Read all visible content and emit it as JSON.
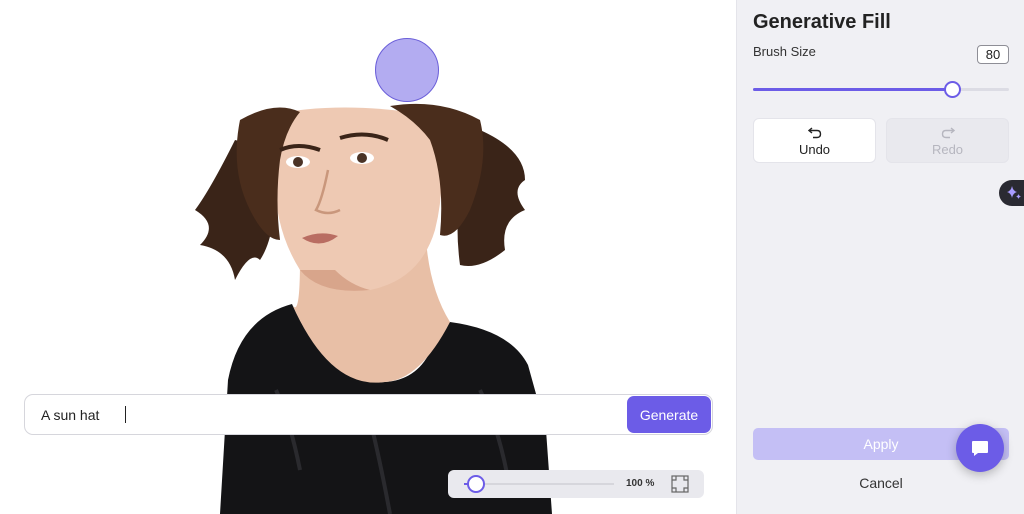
{
  "prompt": {
    "value": "A sun hat",
    "generate_label": "Generate"
  },
  "zoom": {
    "value": "100 %",
    "level_fraction": 0.05
  },
  "panel": {
    "title": "Generative Fill",
    "brush_label": "Brush Size",
    "brush_value": "80",
    "brush_fraction": 0.79,
    "undo_label": "Undo",
    "redo_label": "Redo",
    "apply_label": "Apply",
    "cancel_label": "Cancel"
  },
  "icons": {
    "undo": "undo-icon",
    "redo": "redo-icon",
    "fit": "fit-screen-icon",
    "sparkle": "sparkle-icon",
    "chat": "chat-icon"
  },
  "colors": {
    "accent": "#6c5ce7",
    "apply_disabled": "#c4bff5",
    "panel_bg": "#f0f0f4"
  }
}
